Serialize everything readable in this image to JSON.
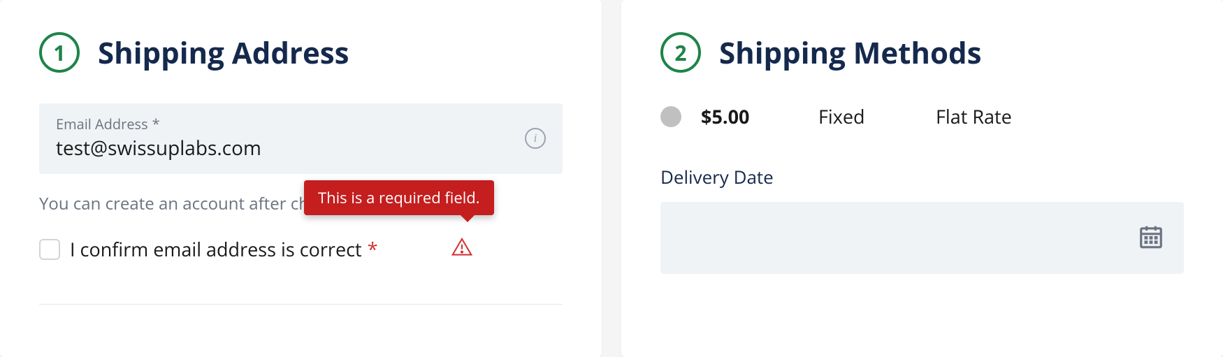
{
  "steps": {
    "shipping_address": {
      "number": "1",
      "title": "Shipping Address",
      "email": {
        "label": "Email Address",
        "value": "test@swissuplabs.com"
      },
      "helper_text": "You can create an account after checkout.",
      "confirm_checkbox": {
        "label": "I confirm email address is correct"
      },
      "error_tooltip": "This is a required field."
    },
    "shipping_methods": {
      "number": "2",
      "title": "Shipping Methods",
      "option": {
        "price": "$5.00",
        "name": "Fixed",
        "type": "Flat Rate"
      },
      "delivery_date_label": "Delivery Date"
    }
  }
}
